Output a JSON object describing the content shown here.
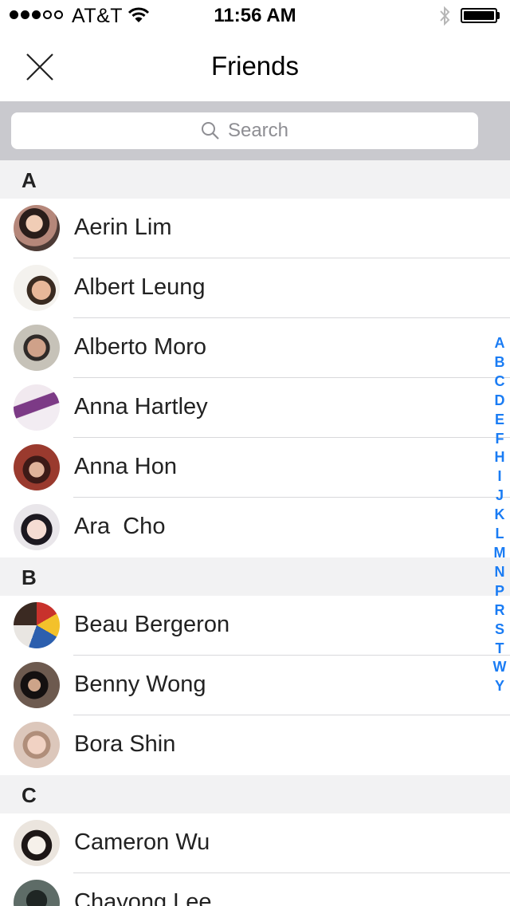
{
  "status_bar": {
    "carrier": "AT&T",
    "time": "11:56 AM",
    "signal_bars": 3,
    "signal_total": 5,
    "battery_level": 1.0,
    "icons": [
      "signal-icon",
      "wifi-icon",
      "bluetooth-icon",
      "battery-icon"
    ]
  },
  "nav": {
    "title": "Friends",
    "close_icon": "close-icon"
  },
  "search": {
    "placeholder": "Search",
    "icon": "search-icon"
  },
  "sections": [
    {
      "letter": "A",
      "friends": [
        {
          "name": "Aerin Lim"
        },
        {
          "name": "Albert Leung"
        },
        {
          "name": "Alberto Moro"
        },
        {
          "name": "Anna Hartley"
        },
        {
          "name": "Anna Hon"
        },
        {
          "name": "Ara  Cho"
        }
      ]
    },
    {
      "letter": "B",
      "friends": [
        {
          "name": "Beau Bergeron"
        },
        {
          "name": "Benny Wong"
        },
        {
          "name": "Bora Shin"
        }
      ]
    },
    {
      "letter": "C",
      "friends": [
        {
          "name": "Cameron Wu"
        },
        {
          "name": "Chayong Lee"
        }
      ]
    }
  ],
  "index": [
    "A",
    "B",
    "C",
    "D",
    "E",
    "F",
    "H",
    "I",
    "J",
    "K",
    "L",
    "M",
    "N",
    "P",
    "R",
    "S",
    "T",
    "W",
    "Y"
  ],
  "colors": {
    "index_blue": "#1a7cf4",
    "search_bar_bg": "#c9c9ce",
    "section_bg": "#f2f2f3",
    "separator": "#d8d8db"
  }
}
